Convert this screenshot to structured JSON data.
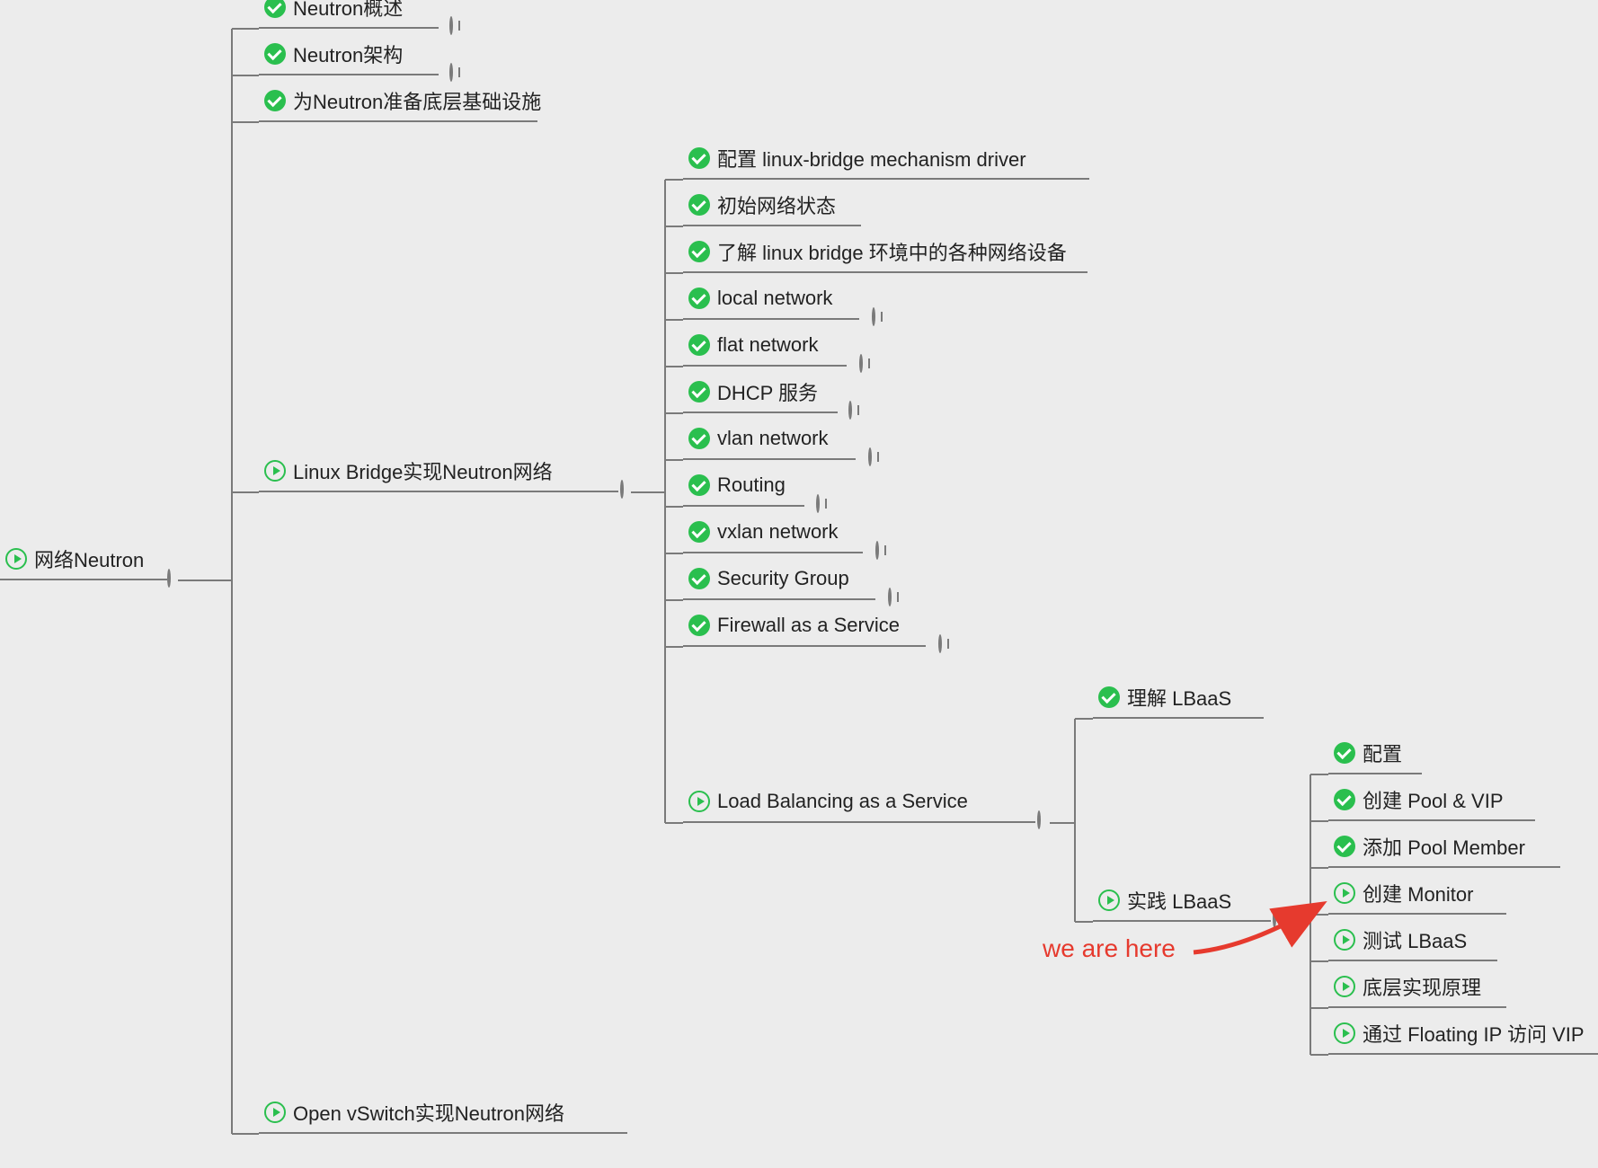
{
  "annotation": "we are here",
  "root": {
    "label": "网络Neutron",
    "status": "play",
    "toggle": "minus"
  },
  "level1": {
    "n_overview": {
      "label": "Neutron概述",
      "status": "done",
      "toggle": "plus"
    },
    "n_arch": {
      "label": "Neutron架构",
      "status": "done",
      "toggle": "plus"
    },
    "n_prep": {
      "label": "为Neutron准备底层基础设施",
      "status": "done"
    },
    "linux_bridge": {
      "label": "Linux Bridge实现Neutron网络",
      "status": "play",
      "toggle": "minus"
    },
    "ovs": {
      "label": "Open vSwitch实现Neutron网络",
      "status": "play"
    }
  },
  "lb": {
    "cfg": {
      "label": "配置 linux-bridge mechanism driver",
      "status": "done"
    },
    "init": {
      "label": "初始网络状态",
      "status": "done"
    },
    "devices": {
      "label": "了解 linux bridge 环境中的各种网络设备",
      "status": "done"
    },
    "local": {
      "label": "local network",
      "status": "done",
      "toggle": "plus"
    },
    "flat": {
      "label": "flat network",
      "status": "done",
      "toggle": "plus"
    },
    "dhcp": {
      "label": "DHCP 服务",
      "status": "done",
      "toggle": "plus"
    },
    "vlan": {
      "label": "vlan network",
      "status": "done",
      "toggle": "plus"
    },
    "routing": {
      "label": "Routing",
      "status": "done",
      "toggle": "plus"
    },
    "vxlan": {
      "label": "vxlan network",
      "status": "done",
      "toggle": "plus"
    },
    "sg": {
      "label": "Security Group",
      "status": "done",
      "toggle": "plus"
    },
    "fwaas": {
      "label": "Firewall as a Service",
      "status": "done",
      "toggle": "plus"
    },
    "lbaas": {
      "label": "Load Balancing as a Service",
      "status": "play",
      "toggle": "minus"
    }
  },
  "lbaas": {
    "understand": {
      "label": "理解 LBaaS",
      "status": "done"
    },
    "practice": {
      "label": "实践 LBaaS",
      "status": "play",
      "toggle": "minus"
    }
  },
  "practice": {
    "cfg": {
      "label": "配置",
      "status": "done"
    },
    "pool": {
      "label": "创建 Pool & VIP",
      "status": "done"
    },
    "member": {
      "label": "添加 Pool Member",
      "status": "done"
    },
    "monitor": {
      "label": "创建 Monitor",
      "status": "play"
    },
    "test": {
      "label": "测试 LBaaS",
      "status": "play"
    },
    "impl": {
      "label": "底层实现原理",
      "status": "play"
    },
    "fip": {
      "label": "通过 Floating IP 访问 VIP",
      "status": "play"
    }
  }
}
